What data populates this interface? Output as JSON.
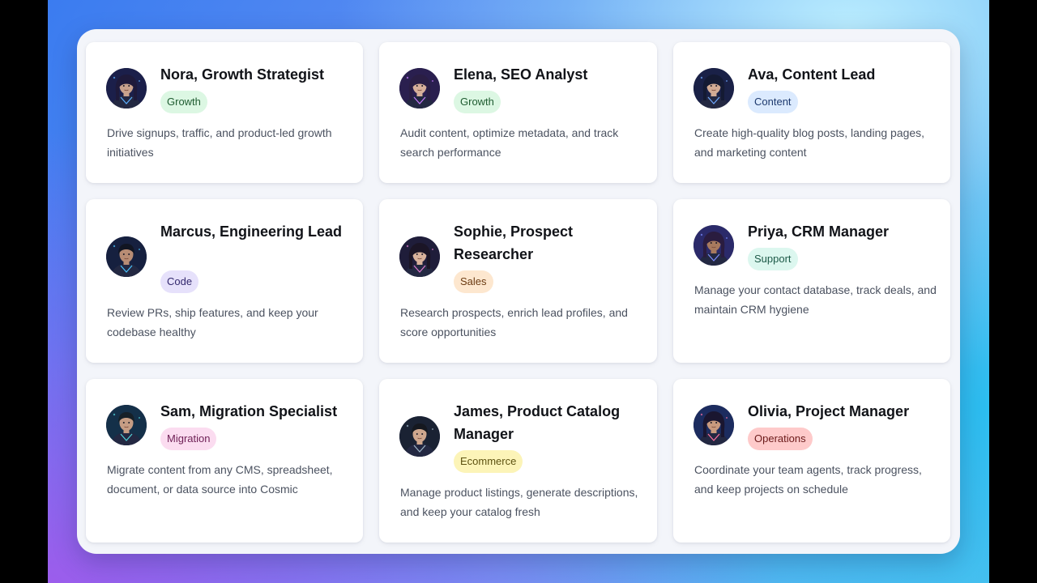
{
  "agents": [
    {
      "name": "Nora, Growth Strategist",
      "tag": "Growth",
      "description": "Drive signups, traffic, and product-led growth initiatives",
      "avatar_icon": "female-agent-avatar-icon",
      "tag_bg": "#dcf7e3",
      "tag_fg": "#1f5c31",
      "avatar_bg": "#1b1f4a",
      "hair": "#1e1a3a",
      "skin": "#c9a38d",
      "accent": "#5bb0ff"
    },
    {
      "name": "Elena, SEO Analyst",
      "tag": "Growth",
      "description": "Audit content, optimize metadata, and track search performance",
      "avatar_icon": "female-agent-avatar-icon",
      "tag_bg": "#dcf7e3",
      "tag_fg": "#1f5c31",
      "avatar_bg": "#2a1f4f",
      "hair": "#2a1e44",
      "skin": "#d7b09a",
      "accent": "#c77cff"
    },
    {
      "name": "Ava, Content Lead",
      "tag": "Content",
      "description": "Create high-quality blog posts, landing pages, and marketing content",
      "avatar_icon": "female-agent-avatar-icon",
      "tag_bg": "#dbeafe",
      "tag_fg": "#1e3a6e",
      "avatar_bg": "#1a2147",
      "hair": "#141a33",
      "skin": "#d2ab94",
      "accent": "#6fa8ff"
    },
    {
      "name": "Marcus, Engineering Lead",
      "tag": "Code",
      "description": "Review PRs, ship features, and keep your codebase healthy",
      "avatar_icon": "male-agent-avatar-icon",
      "tag_bg": "#e6e1fb",
      "tag_fg": "#33286e",
      "avatar_bg": "#16203f",
      "hair": "#111522",
      "skin": "#b88c74",
      "accent": "#49c4ff"
    },
    {
      "name": "Sophie, Prospect Researcher",
      "tag": "Sales",
      "description": "Research prospects, enrich lead profiles, and score opportunities",
      "avatar_icon": "female-agent-avatar-icon",
      "tag_bg": "#fde7cf",
      "tag_fg": "#6b3a12",
      "avatar_bg": "#1f1d3a",
      "hair": "#1b1526",
      "skin": "#d9b39c",
      "accent": "#e07ad0"
    },
    {
      "name": "Priya, CRM Manager",
      "tag": "Support",
      "description": "Manage your contact database, track deals, and maintain CRM hygiene",
      "avatar_icon": "female-agent-avatar-icon",
      "tag_bg": "#dcf7ef",
      "tag_fg": "#1d5a48",
      "avatar_bg": "#2b2a6a",
      "hair": "#2a1c3f",
      "skin": "#a87a5e",
      "accent": "#7d8cff"
    },
    {
      "name": "Sam, Migration Specialist",
      "tag": "Migration",
      "description": "Migrate content from any CMS, spreadsheet, document, or data source into Cosmic",
      "avatar_icon": "male-agent-avatar-icon",
      "tag_bg": "#fbdcf0",
      "tag_fg": "#6e1f55",
      "avatar_bg": "#143049",
      "hair": "#162028",
      "skin": "#c69d84",
      "accent": "#4fd3d9"
    },
    {
      "name": "James, Product Catalog Manager",
      "tag": "Ecommerce",
      "description": "Manage product listings, generate descriptions, and keep your catalog fresh",
      "avatar_icon": "male-agent-avatar-icon",
      "tag_bg": "#fcf4b8",
      "tag_fg": "#5e5312",
      "avatar_bg": "#1a2233",
      "hair": "#15181f",
      "skin": "#cfa78e",
      "accent": "#9fb6c9"
    },
    {
      "name": "Olivia, Project Manager",
      "tag": "Operations",
      "description": "Coordinate your team agents, track progress, and keep projects on schedule",
      "avatar_icon": "female-agent-avatar-icon",
      "tag_bg": "#fecaca",
      "tag_fg": "#6b1a1a",
      "avatar_bg": "#1c2c5f",
      "hair": "#1a1630",
      "skin": "#c99a7e",
      "accent": "#ff6fa3"
    }
  ]
}
